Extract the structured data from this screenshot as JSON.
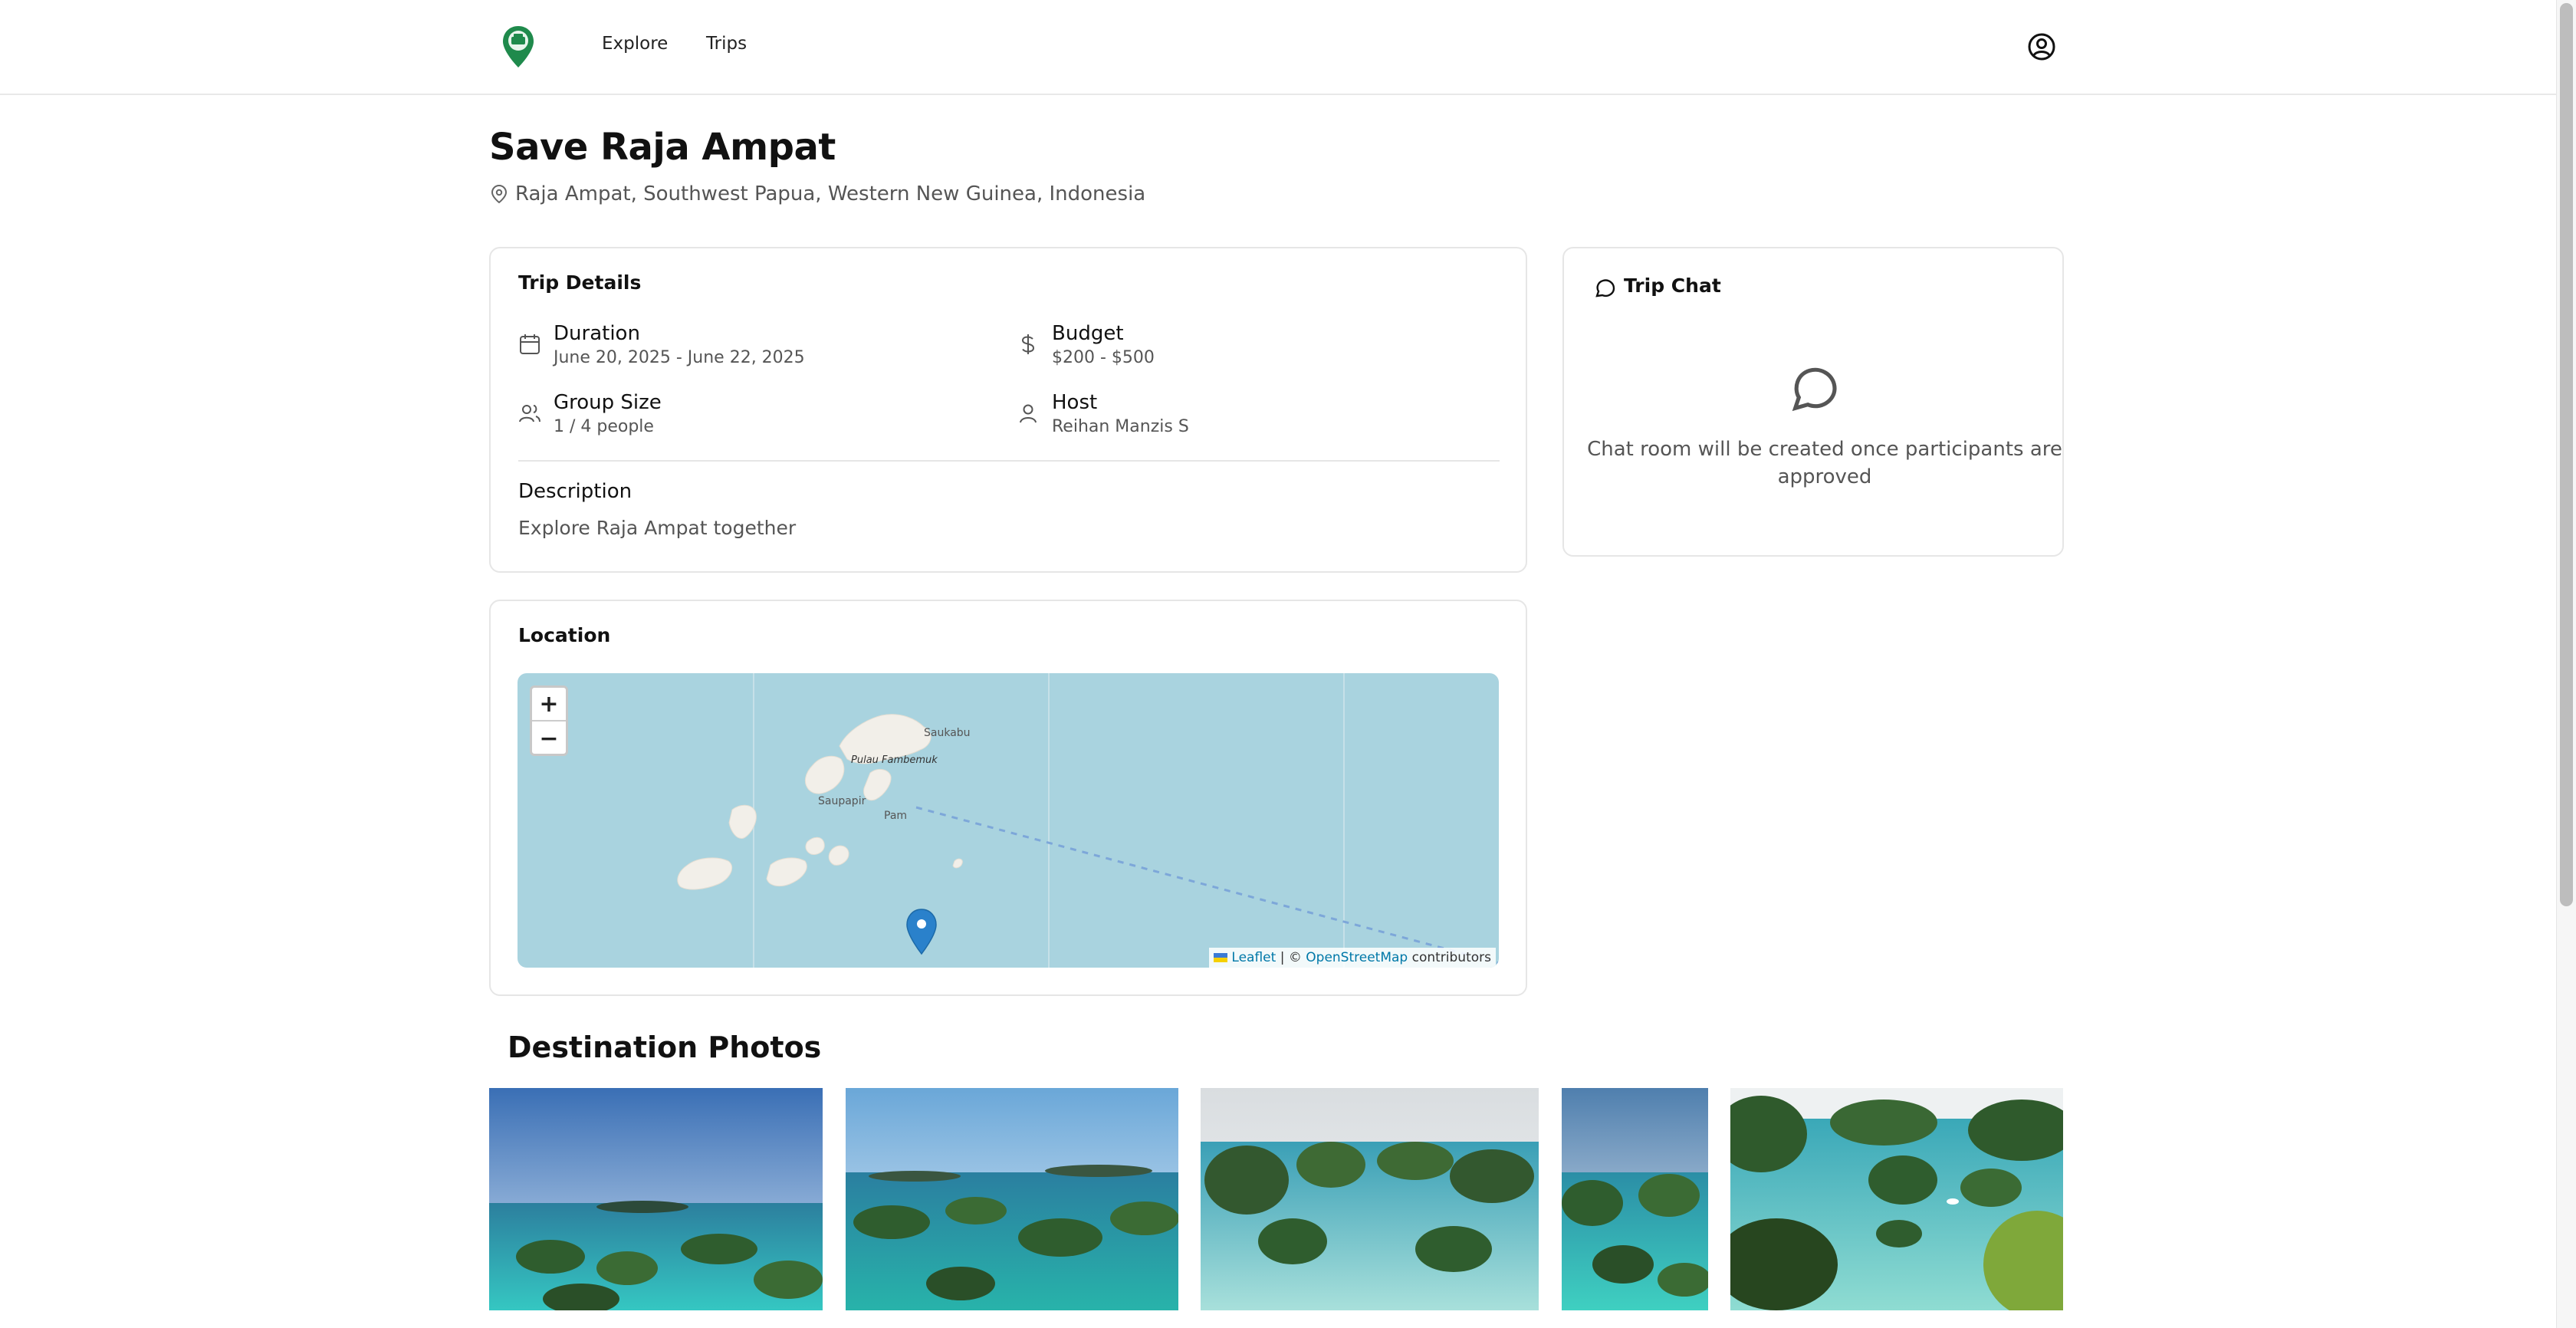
{
  "nav": {
    "logo_icon": "map-pin-logo-icon",
    "links": [
      {
        "label": "Explore"
      },
      {
        "label": "Trips"
      }
    ],
    "user_icon": "user-circle-icon"
  },
  "page": {
    "title": "Save Raja Ampat",
    "location": "Raja Ampat, Southwest Papua, Western New Guinea, Indonesia"
  },
  "trip_details": {
    "heading": "Trip Details",
    "duration": {
      "label": "Duration",
      "value": "June 20, 2025 - June 22, 2025",
      "icon": "calendar-icon"
    },
    "budget": {
      "label": "Budget",
      "value": "$200 - $500",
      "icon": "dollar-icon"
    },
    "group_size": {
      "label": "Group Size",
      "value": "1 / 4 people",
      "icon": "users-icon"
    },
    "host": {
      "label": "Host",
      "value": "Reihan Manzis S",
      "icon": "user-icon"
    },
    "description_label": "Description",
    "description": "Explore Raja Ampat together"
  },
  "location_card": {
    "heading": "Location",
    "zoom_in": "+",
    "zoom_out": "−",
    "map_labels": [
      "Saukabu",
      "Pulau Fambemuk",
      "Saupapir",
      "Pam"
    ],
    "attribution": {
      "leaflet": "Leaflet",
      "sep": " | © ",
      "osm": "OpenStreetMap",
      "suffix": " contributors"
    }
  },
  "chat": {
    "heading": "Trip Chat",
    "icon": "message-circle-icon",
    "empty_message": "Chat room will be created once participants are approved"
  },
  "photos": {
    "heading": "Destination Photos"
  },
  "colors": {
    "accent": "#1f8a4c",
    "map_water": "#a9d3df",
    "map_land": "#f2efe9",
    "marker": "#2a81cb"
  }
}
